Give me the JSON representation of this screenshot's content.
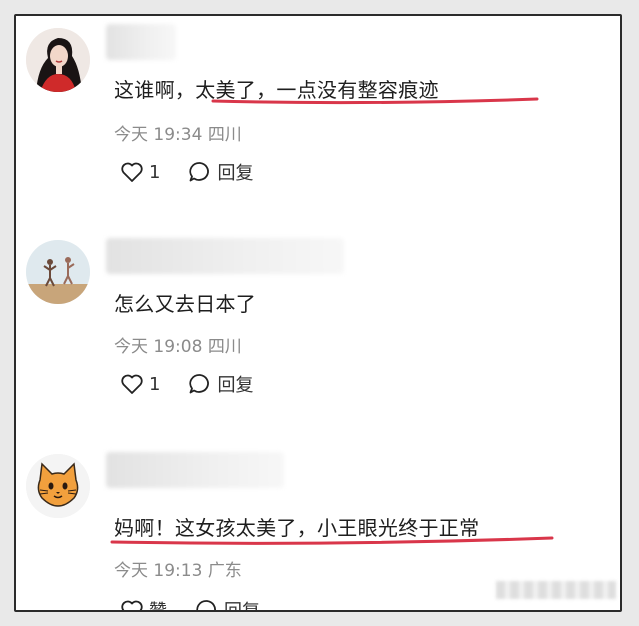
{
  "comments": [
    {
      "text": "这谁啊，太美了，一点没有整容痕迹",
      "time": "今天 19:34",
      "location": "四川",
      "like_label": "1",
      "reply_label": "回复"
    },
    {
      "text": "怎么又去日本了",
      "time": "今天 19:08",
      "location": "四川",
      "like_label": "1",
      "reply_label": "回复"
    },
    {
      "text": "妈啊！这女孩太美了，小王眼光终于正常",
      "time": "今天 19:13",
      "location": "广东",
      "like_label": "赞",
      "reply_label": "回复"
    }
  ],
  "colors": {
    "underline": "#d9364a",
    "text": "#1e1e1e",
    "meta": "#8b8b8b",
    "border": "#2b2b2b"
  },
  "icons": {
    "like": "heart-outline-icon",
    "reply": "speech-bubble-icon",
    "avatar3": "orange-cat-face-icon"
  }
}
